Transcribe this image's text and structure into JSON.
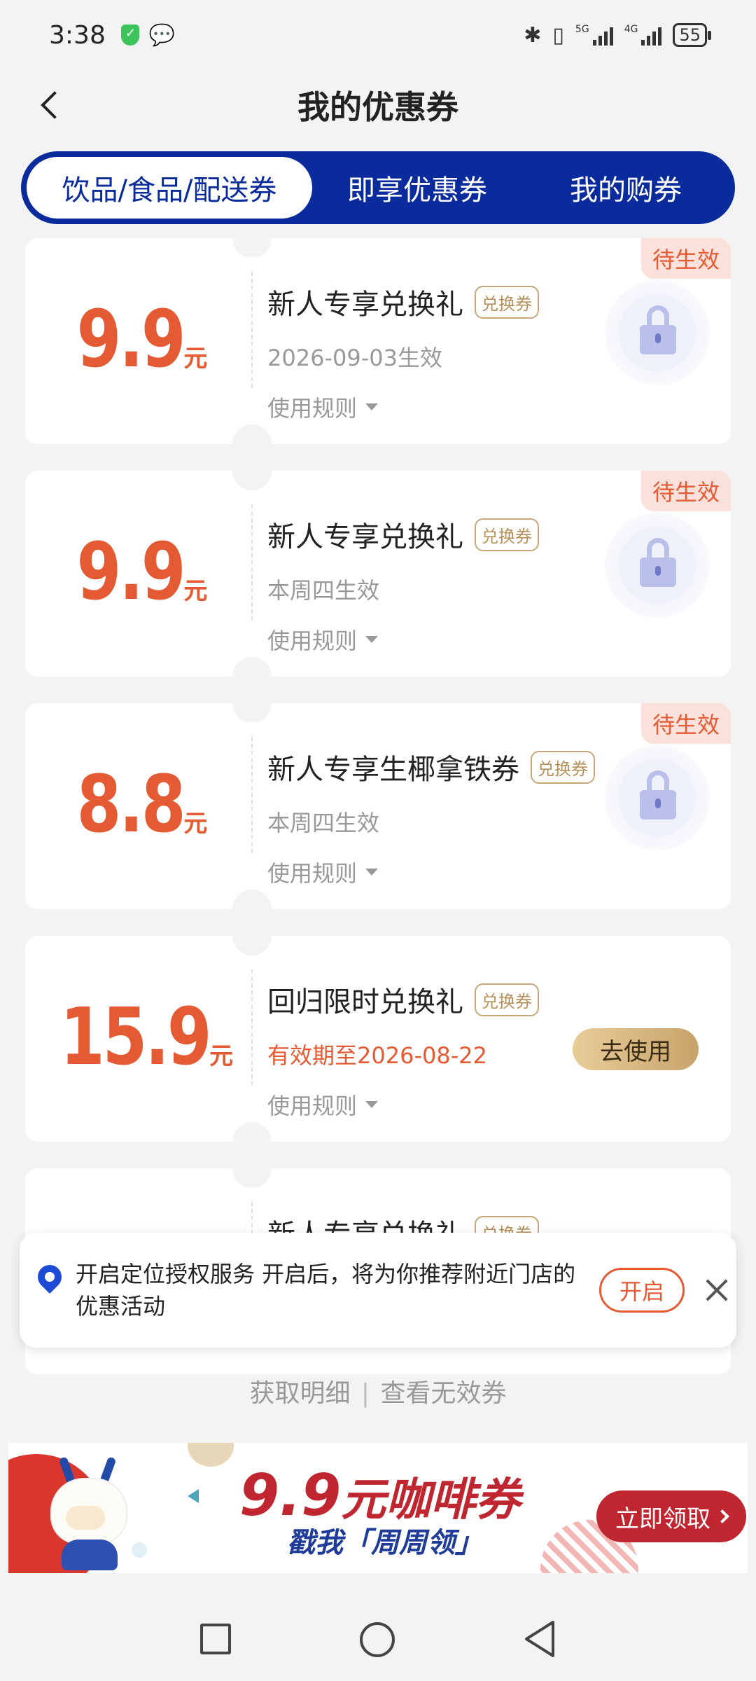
{
  "status_bar": {
    "time": "3:38",
    "battery": "55",
    "net1": "5G",
    "net2": "4G"
  },
  "header": {
    "title": "我的优惠券"
  },
  "tabs": [
    {
      "label": "饮品/食品/配送券"
    },
    {
      "label": "即享优惠券"
    },
    {
      "label": "我的购券"
    }
  ],
  "coupons": [
    {
      "price": "9.9",
      "unit": "元",
      "name": "新人专享兑换礼",
      "tag": "兑换券",
      "date": "2026-09-03生效",
      "rules": "使用规则",
      "status": "待生效"
    },
    {
      "price": "9.9",
      "unit": "元",
      "name": "新人专享兑换礼",
      "tag": "兑换券",
      "date": "本周四生效",
      "rules": "使用规则",
      "status": "待生效"
    },
    {
      "price": "8.8",
      "unit": "元",
      "name": "新人专享生椰拿铁券",
      "tag": "兑换券",
      "date": "本周四生效",
      "rules": "使用规则",
      "status": "待生效"
    },
    {
      "price": "15.9",
      "unit": "元",
      "name": "回归限时兑换礼",
      "tag": "兑换券",
      "date": "有效期至2026-08-22",
      "rules": "使用规则",
      "action": "去使用"
    },
    {
      "name": "新人专享兑换礼",
      "tag": "兑换券"
    }
  ],
  "location_banner": {
    "text": "开启定位授权服务 开启后，将为你推荐附近门店的优惠活动",
    "button": "开启"
  },
  "footer_links": {
    "details": "获取明细",
    "separator": "|",
    "invalid": "查看无效券"
  },
  "promo": {
    "price": "9.9",
    "headline": "元咖啡券",
    "sub": "戳我「周周领」",
    "button": "立即领取"
  },
  "colors": {
    "brand_blue": "#0a2b9c",
    "price_red": "#e45a32",
    "promo_red": "#c0262f"
  }
}
